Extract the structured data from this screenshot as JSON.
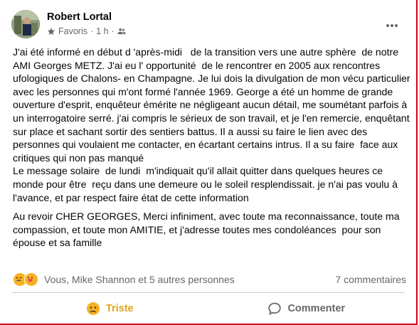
{
  "post": {
    "author": "Robert Lortal",
    "audience": "Favoris",
    "time": "1 h",
    "separator": "·",
    "paragraph1": "J'ai été informé en début d 'après-midi   de la transition vers une autre sphère  de notre AMI Georges METZ. J'ai eu l' opportunité  de le rencontrer en 2005 aux rencontres ufologiques de Chalons- en Champagne. Je lui dois la divulgation de mon vécu particulier avec les personnes qui m'ont formé l'année 1969. George a été un homme de grande  ouverture d'esprit, enquêteur émérite ne négligeant aucun détail, me soumétant parfois à un interrogatoire serré. j'ai compris le sérieux de son travail, et je l'en remercie, enquêtant  sur place et sachant sortir des sentiers battus. Il a aussi su faire le lien avec des personnes qui voulaient me contacter, en écartant certains intrus. Il a su faire  face aux critiques qui non pas manqué\nLe message solaire  de lundi  m'indiquait qu'il allait quitter dans quelques heures ce monde pour être  reçu dans une demeure ou le soleil resplendissait. je n'ai pas voulu à l'avance, et par respect faire état de cette information",
    "paragraph2": "Au revoir CHER GEORGES, Merci infiniment, avec toute ma reconnaissance, toute ma compassion, et toute mon AMITIE, et j'adresse toutes mes condoléances  pour son épouse et sa famille"
  },
  "reactions": {
    "summary": "Vous, Mike Shannon et 5 autres personnes",
    "comments": "7 commentaires",
    "colors": {
      "sad": "#f7b125",
      "care": "#f7b125"
    }
  },
  "actions": {
    "reaction_label": "Triste",
    "comment_label": "Commenter"
  }
}
